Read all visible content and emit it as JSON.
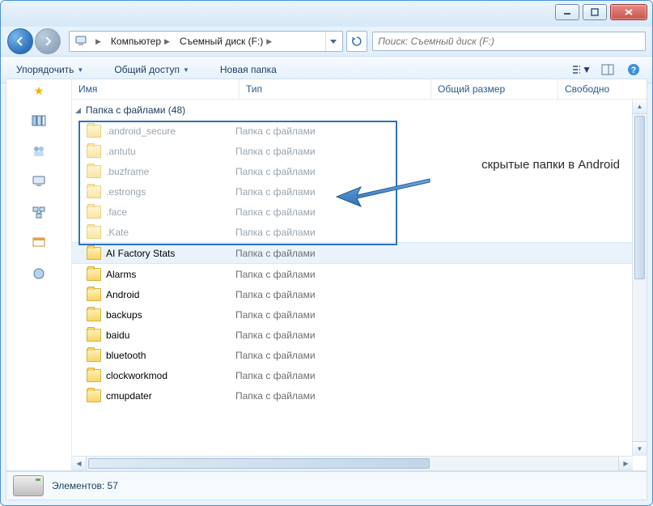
{
  "breadcrumb": {
    "root_icon": "computer-icon",
    "items": [
      "Компьютер",
      "Съемный диск (F:)"
    ]
  },
  "search": {
    "placeholder": "Поиск: Съемный диск (F:)"
  },
  "toolbar": {
    "organize": "Упорядочить",
    "share": "Общий доступ",
    "new_folder": "Новая папка"
  },
  "columns": {
    "name": "Имя",
    "type": "Тип",
    "size": "Общий размер",
    "free": "Свободно"
  },
  "group": {
    "label": "Папка с файлами (48)"
  },
  "file_type_label": "Папка с файлами",
  "annotation": "скрытые папки в Android",
  "hidden_folders": [
    ".android_secure",
    ".antutu",
    ".buzframe",
    ".estrongs",
    ".face",
    ".Kate"
  ],
  "folders": [
    "AI Factory Stats",
    "Alarms",
    "Android",
    "backups",
    "baidu",
    "bluetooth",
    "clockworkmod",
    "cmupdater"
  ],
  "selected_index": 0,
  "status": {
    "label": "Элементов:",
    "count": "57"
  },
  "colors": {
    "accent": "#2f72b8"
  }
}
